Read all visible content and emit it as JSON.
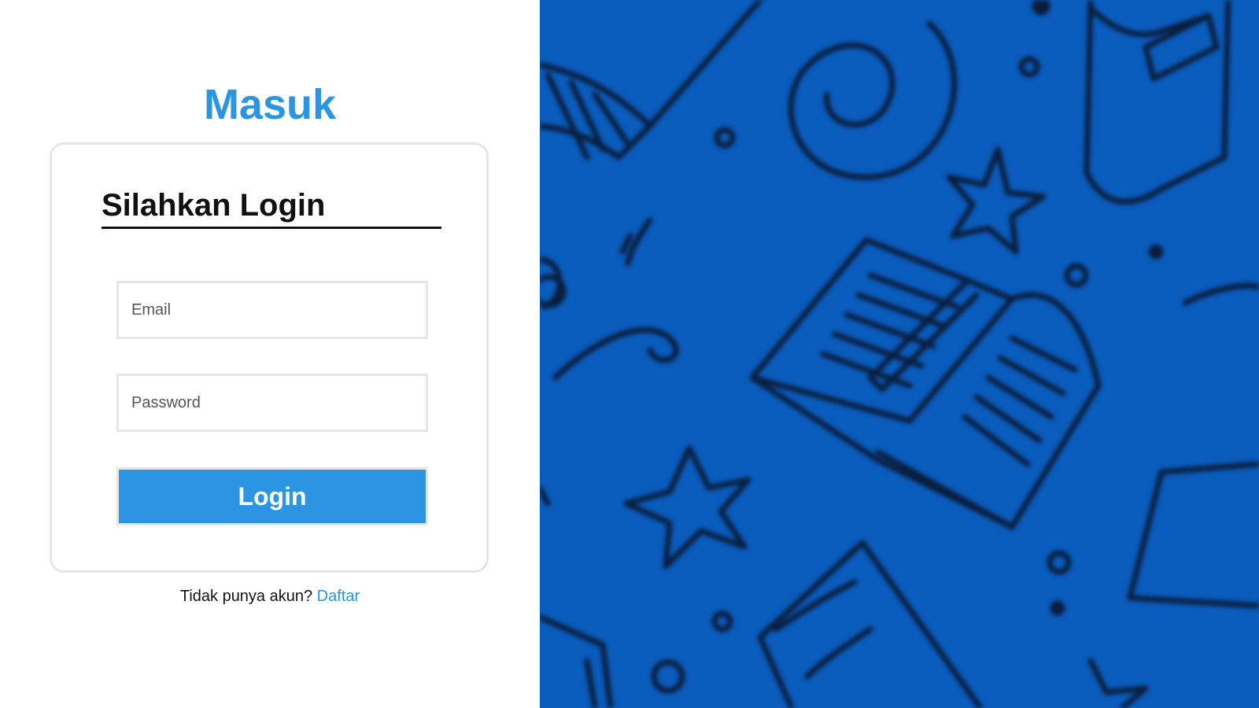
{
  "page": {
    "title": "Masuk"
  },
  "card": {
    "heading": "Silahkan Login"
  },
  "form": {
    "email": {
      "value": "",
      "placeholder": "Email"
    },
    "password": {
      "value": "",
      "placeholder": "Password"
    },
    "login_label": "Login"
  },
  "signup": {
    "prompt": "Tidak punya akun?",
    "link_label": "Daftar"
  },
  "background": {
    "color": "#0a5cbd",
    "pattern": [
      "open-book-icon",
      "closed-book-icon",
      "star-icon",
      "spiral-icon",
      "dot-icon"
    ]
  },
  "colors": {
    "accent": "#2b95e3",
    "text": "#111111",
    "border": "#e6e6e6"
  }
}
